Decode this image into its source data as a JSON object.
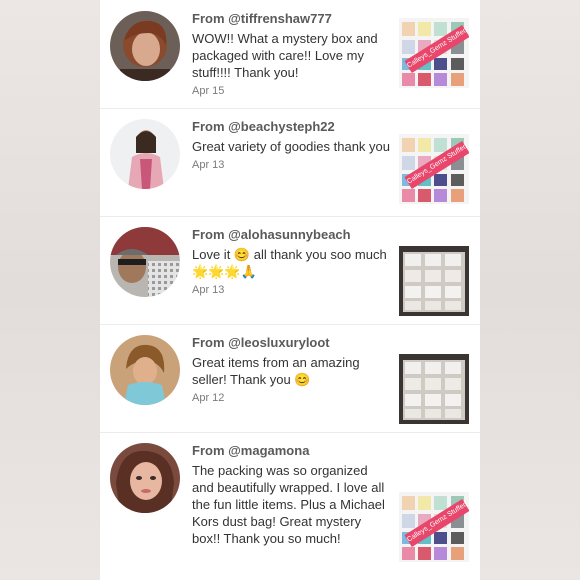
{
  "reviews": [
    {
      "from": "From @tiffrenshaw777",
      "message": "WOW!! What a mystery box and packaged with care!! Love my stuff!!!! Thank you!",
      "date": "Apr 15",
      "avatar_icon": "user-photo-icon",
      "thumb_type": "bags"
    },
    {
      "from": "From @beachysteph22",
      "message": "Great variety of goodies thank you",
      "date": "Apr 13",
      "avatar_icon": "user-photo-icon",
      "thumb_type": "bags"
    },
    {
      "from": "From @alohasunnybeach",
      "message": "Love it 😊 all thank you soo much 🌟🌟🌟🙏",
      "date": "Apr 13",
      "avatar_icon": "user-photo-icon",
      "thumb_type": "boxes"
    },
    {
      "from": "From @leosluxuryloot",
      "message": "Great items from an amazing seller! Thank you 😊",
      "date": "Apr 12",
      "avatar_icon": "user-photo-icon",
      "thumb_type": "boxes"
    },
    {
      "from": "From @magamona",
      "message": "The packing was so organized and beautifully wrapped. I love all the fun little items. Plus a Michael Kors dust bag! Great mystery box!! Thank you so much!",
      "date": "",
      "avatar_icon": "user-photo-icon",
      "thumb_type": "bags"
    }
  ],
  "thumb_banner_text": "Calleys_Gemz Stuffed",
  "colors": {
    "background": "#e9e4e2",
    "card": "#ffffff",
    "from_text": "#5a5a5a",
    "message_text": "#333333",
    "date_text": "#7a7a7a",
    "banner": "#e8476b"
  }
}
